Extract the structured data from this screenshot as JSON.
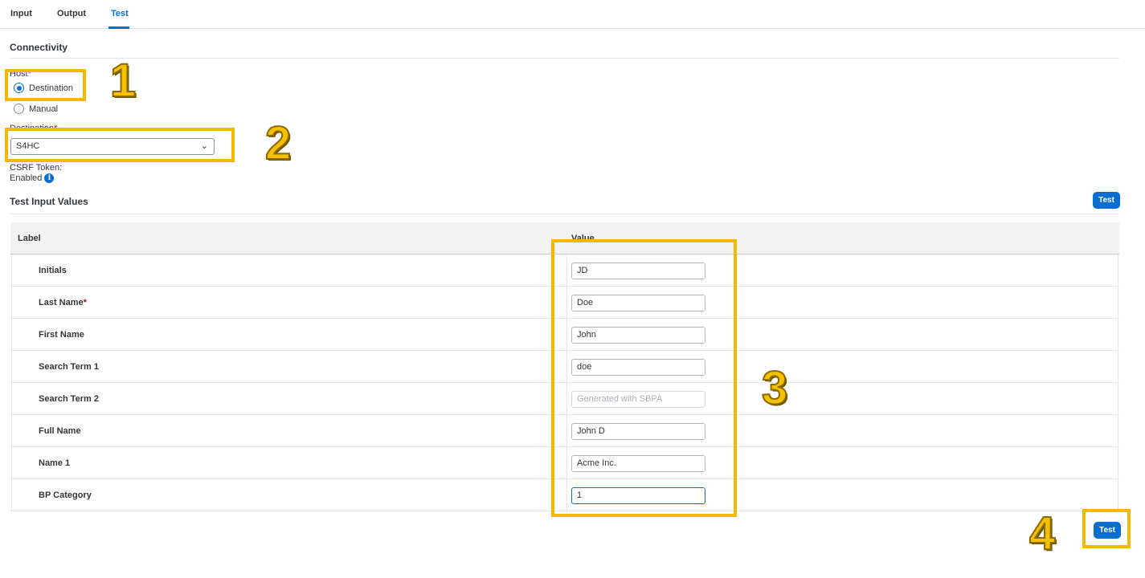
{
  "tabs": [
    {
      "label": "Input"
    },
    {
      "label": "Output"
    },
    {
      "label": "Test",
      "active": true
    }
  ],
  "connectivity": {
    "title": "Connectivity",
    "host_label": "Host",
    "host_required": "*",
    "options": [
      {
        "label": "Destination",
        "selected": true
      },
      {
        "label": "Manual",
        "selected": false
      }
    ],
    "destination_label": "Destination",
    "destination_required": "*",
    "destination_value": "S4HC",
    "csrf_label": "CSRF Token:",
    "csrf_value": "Enabled"
  },
  "test_input": {
    "title": "Test Input Values",
    "test_button": "Test",
    "columns": [
      "Label",
      "Value"
    ],
    "rows": [
      {
        "label": "Initials",
        "required": "",
        "value": "JD"
      },
      {
        "label": "Last Name",
        "required": "*",
        "value": "Doe"
      },
      {
        "label": "First Name",
        "required": "",
        "value": "John"
      },
      {
        "label": "Search Term 1",
        "required": "",
        "value": "doe"
      },
      {
        "label": "Search Term 2",
        "required": "",
        "value": "",
        "placeholder": "Generated with SBPA"
      },
      {
        "label": "Full Name",
        "required": "",
        "value": "John D"
      },
      {
        "label": "Name 1",
        "required": "",
        "value": "Acme Inc."
      },
      {
        "label": "BP Category",
        "required": "",
        "value": "1"
      }
    ]
  },
  "footer": {
    "test_button": "Test"
  },
  "annotations": {
    "callout_1": "1",
    "callout_2": "2",
    "callout_3": "3",
    "callout_4": "4",
    "highlight_color": "#f5b800"
  },
  "colors": {
    "accent": "#0a6ed1",
    "required": "#bb0000"
  }
}
